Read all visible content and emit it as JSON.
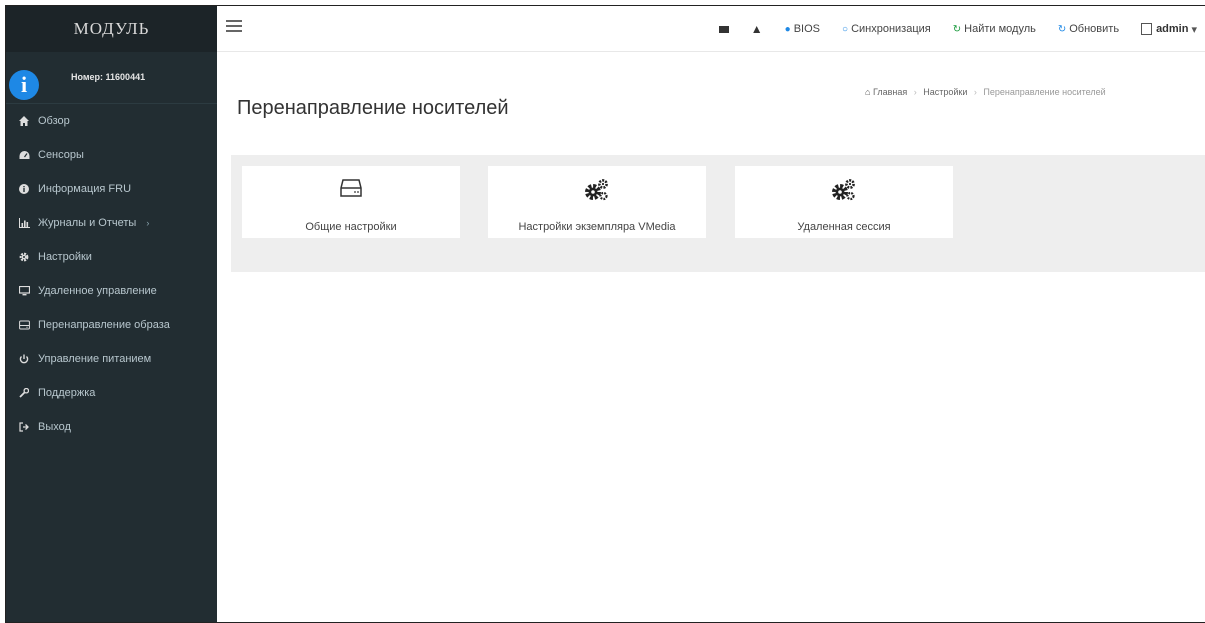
{
  "brand": "МОДУЛЬ",
  "user": {
    "number": "Номер: 11600441"
  },
  "sidebar": {
    "items": [
      {
        "label": "Обзор",
        "icon": "home-icon"
      },
      {
        "label": "Сенсоры",
        "icon": "dashboard-icon"
      },
      {
        "label": "Информация FRU",
        "icon": "info-icon"
      },
      {
        "label": "Журналы и Отчеты",
        "icon": "chart-icon",
        "chevron": "›"
      },
      {
        "label": "Настройки",
        "icon": "gear-icon"
      },
      {
        "label": "Удаленное управление",
        "icon": "monitor-icon"
      },
      {
        "label": "Перенаправление образа",
        "icon": "drive-icon"
      },
      {
        "label": "Управление питанием",
        "icon": "power-icon"
      },
      {
        "label": "Поддержка",
        "icon": "wrench-icon"
      },
      {
        "label": "Выход",
        "icon": "sign-out-icon"
      }
    ]
  },
  "topbar": {
    "bios": "BIOS",
    "sync": "Синхронизация",
    "find_module": "Найти модуль",
    "refresh": "Обновить",
    "user": "admin",
    "caret": "▾"
  },
  "page": {
    "title": "Перенаправление носителей",
    "breadcrumb": {
      "home": "Главная",
      "settings": "Настройки",
      "current": "Перенаправление носителей"
    }
  },
  "tiles": [
    {
      "label": "Общие настройки",
      "icon": "hdd-icon"
    },
    {
      "label": "Настройки экземпляра VMedia",
      "icon": "gears-icon"
    },
    {
      "label": "Удаленная сессия",
      "icon": "gears-icon"
    }
  ],
  "colors": {
    "sidebar": "#222d32",
    "accent": "#1e88e5",
    "content_band": "#eeeeee"
  }
}
